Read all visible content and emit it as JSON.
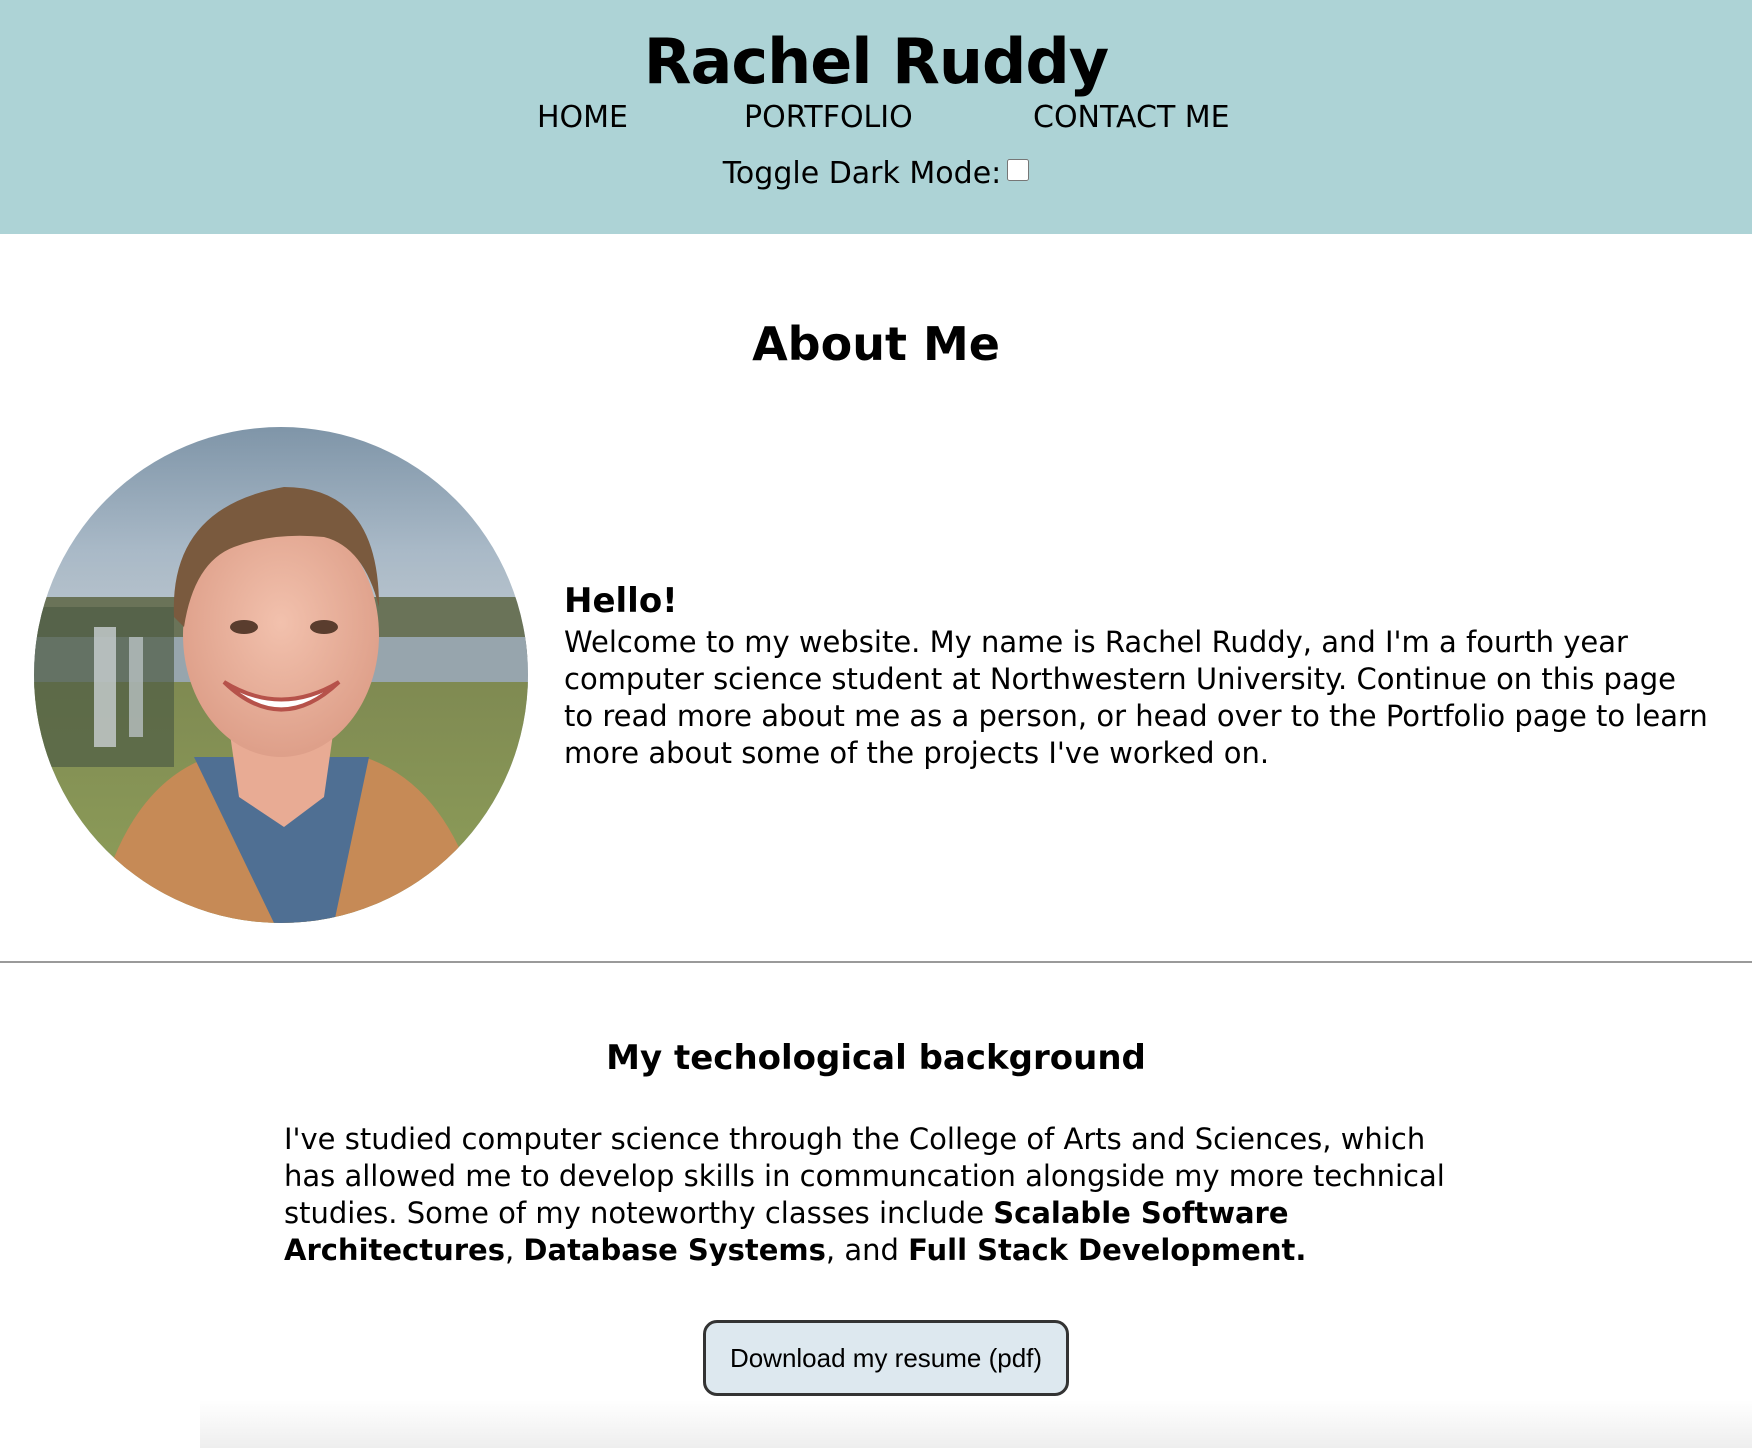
{
  "header": {
    "title": "Rachel Ruddy",
    "nav": [
      {
        "label": "HOME"
      },
      {
        "label": "PORTFOLIO"
      },
      {
        "label": "CONTACT ME"
      }
    ],
    "toggle_label": "Toggle Dark Mode:",
    "dark_mode_checked": false,
    "background_color": "#add3d6"
  },
  "about": {
    "title": "About Me",
    "greeting": "Hello!",
    "intro": "Welcome to my website. My name is Rachel Ruddy, and I'm a fourth year computer science student at Northwestern University. Continue on this page to read more about me as a person, or head over to the Portfolio page to learn more about some of the projects I've worked on."
  },
  "background": {
    "title": "My techological background",
    "text_start": "I've studied computer science through the College of Arts and Sciences, which has allowed me to develop skills in communcation alongside my more technical studies. Some of my noteworthy classes include ",
    "class_1": "Scalable Software Architectures",
    "sep_1": ", ",
    "class_2": "Database Systems",
    "sep_2": ", and ",
    "class_3": "Full Stack Development."
  },
  "resume_button_label": "Download my resume (pdf)"
}
